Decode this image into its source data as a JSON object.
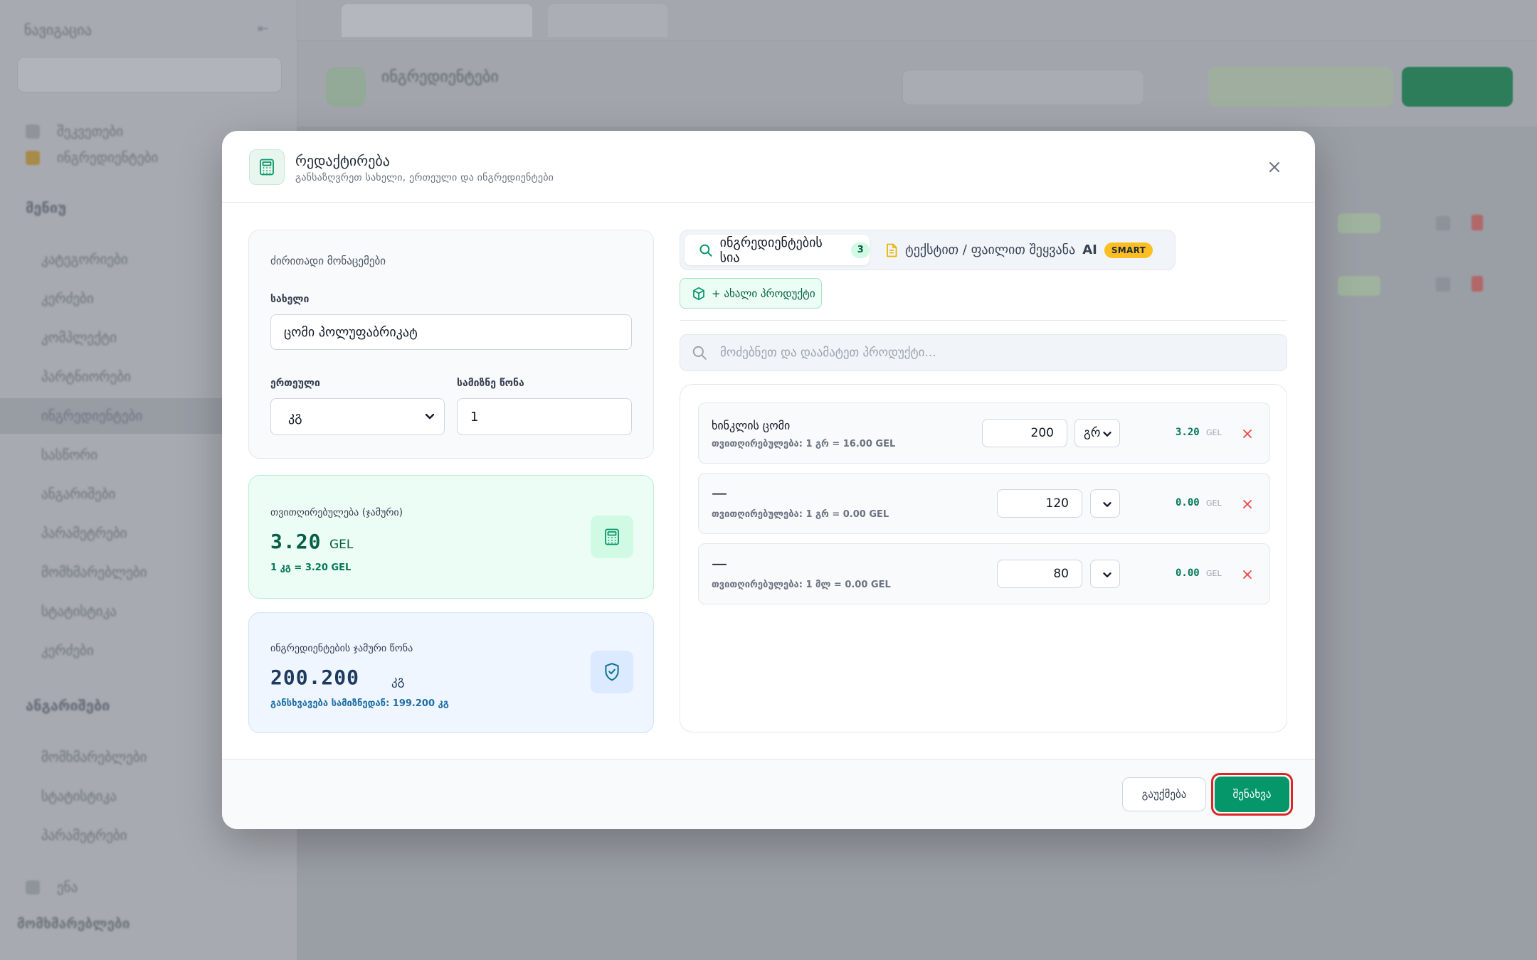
{
  "background": {
    "sidebar_items": [
      "ნავიგაცია",
      "შეკვეთები",
      "ინგრედიენტები",
      "მენიუ",
      "კატეგორიები",
      "კერძები",
      "კომპლექტი",
      "პარტნიორები",
      "სასწორი",
      "ანგარიშები",
      "პარამეტრები",
      "მომხმარებლები",
      "სტატისტიკა",
      "ენა"
    ]
  },
  "modal": {
    "title": "რედაქტირება",
    "subtitle": "განსაზღვრეთ სახელი, ერთეული და ინგრედიენტები",
    "main_card": {
      "section_title": "ძირითადი მონაცემები",
      "name_label": "სახელი",
      "name_value": "ცომი პოლუფაბრიკატ",
      "unit_label": "ერთეული",
      "unit_value": "კგ",
      "weight_label": "სამიზნე წონა",
      "weight_value": "1"
    },
    "cost_card": {
      "title": "თვითღირებულება (ჯამური)",
      "value": "3.20",
      "currency": "GEL",
      "footnote": "1 კგ = 3.20 GEL"
    },
    "weight_card": {
      "title": "ინგრედიენტების ჯამური წონა",
      "value": "200.200",
      "unit": "კგ",
      "footnote": "განსხვავება სამიზნედან: 199.200 კგ"
    },
    "tabs": {
      "list_label": "ინგრედიენტების სია",
      "list_count": "3",
      "text_label": "ტექსტით / ფაილით შეყვანა",
      "ai_label": "AI",
      "smart_badge": "SMART"
    },
    "new_product_label": "+ ახალი პროდუქტი",
    "search_placeholder": "მოძებნეთ და დაამატეთ პროდუქტი...",
    "ingredients": [
      {
        "name": "ხინკლის ცომი",
        "meta": "თვითღირებულება: 1 გრ = 16.00 GEL",
        "qty": "200",
        "unit": "გრ",
        "price": "3.20",
        "currency": "GEL"
      },
      {
        "name": "—",
        "meta": "თვითღირებულება: 1 გრ = 0.00 GEL",
        "qty": "120",
        "unit": "",
        "price": "0.00",
        "currency": "GEL"
      },
      {
        "name": "—",
        "meta": "თვითღირებულება: 1 მლ = 0.00 GEL",
        "qty": "80",
        "unit": "",
        "price": "0.00",
        "currency": "GEL"
      }
    ],
    "footer": {
      "cancel_label": "გაუქმება",
      "save_label": "შენახვა"
    }
  },
  "colors": {
    "accent": "#059669",
    "highlight_ring": "#dc2626",
    "danger": "#ef4444"
  }
}
